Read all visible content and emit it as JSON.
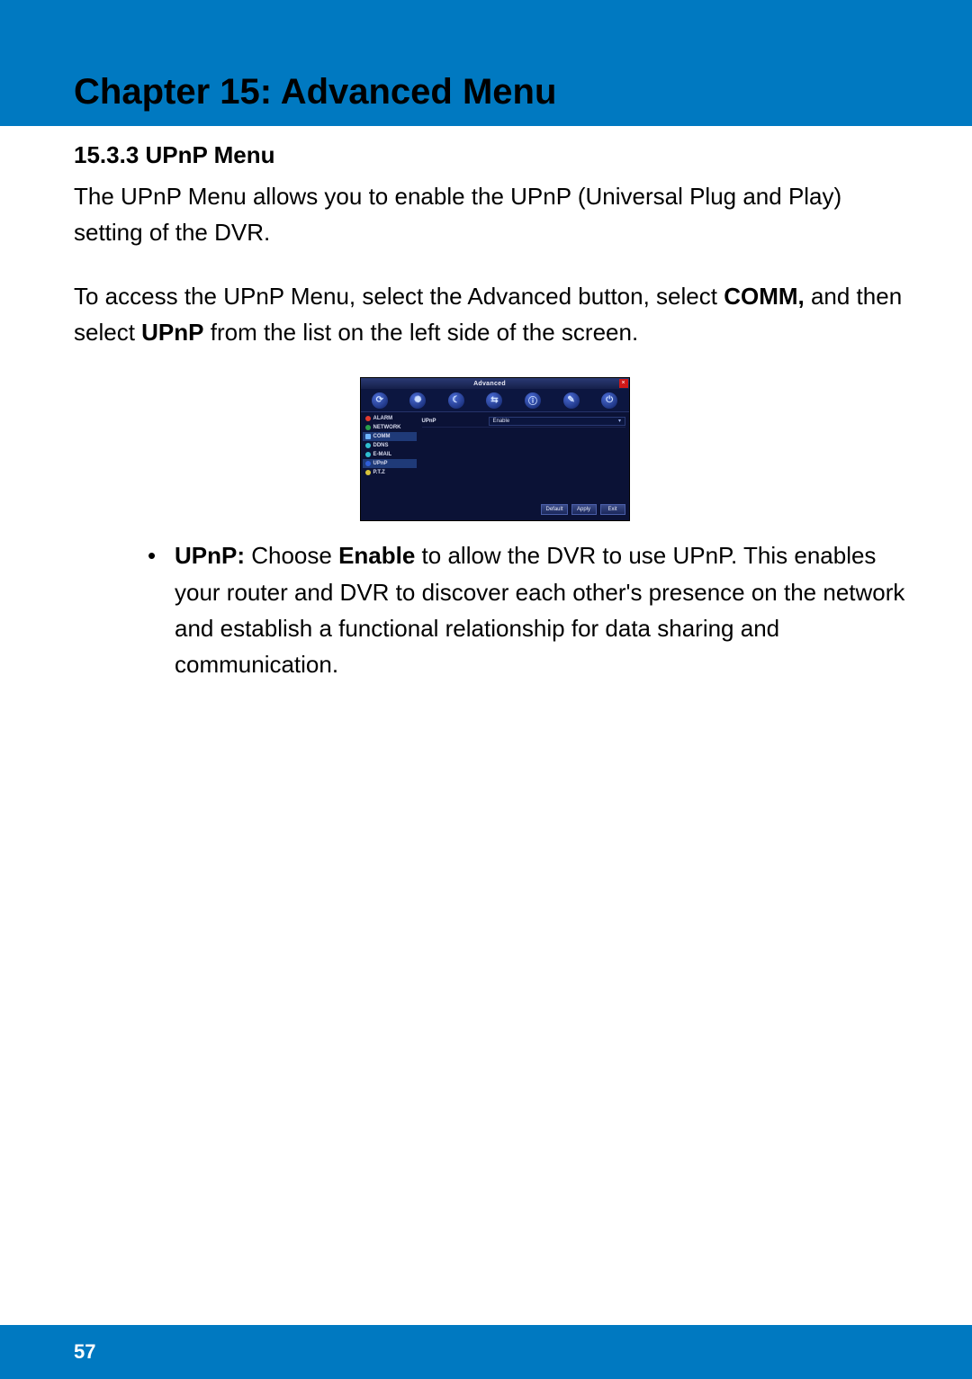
{
  "chapter_title": "Chapter 15: Advanced Menu",
  "section_number_title": "15.3.3 UPnP Menu",
  "para1": "The UPnP Menu allows you to enable the UPnP (Universal Plug and Play) setting of the DVR.",
  "para2_a": "To access the UPnP Menu, select the Advanced button, select ",
  "para2_bold1": "COMM, ",
  "para2_b": "and then select ",
  "para2_bold2": "UPnP",
  "para2_c": " from the list on the left side of the screen.",
  "bullet1_label": "UPnP: ",
  "bullet1_a": "Choose ",
  "bullet1_bold": "Enable",
  "bullet1_b": " to allow the DVR to use UPnP. This enables your router and DVR to discover each other's presence on the network and establish a functional relationship for data sharing and communication.",
  "page_number": "57",
  "dvr": {
    "title": "Advanced",
    "close": "×",
    "icons": [
      "⟳",
      "✺",
      "☾",
      "⇆",
      "ⓘ",
      "✎",
      "⏻"
    ],
    "side": {
      "alarm": "ALARM",
      "network": "NETWORK",
      "comm": "COMM",
      "ddns": "DDNS",
      "email": "E-MAIL",
      "upnp": "UPnP",
      "ptz": "P.T.Z"
    },
    "row_label": "UPnP",
    "row_value": "Enable",
    "btn_default": "Default",
    "btn_apply": "Apply",
    "btn_exit": "Exit"
  }
}
